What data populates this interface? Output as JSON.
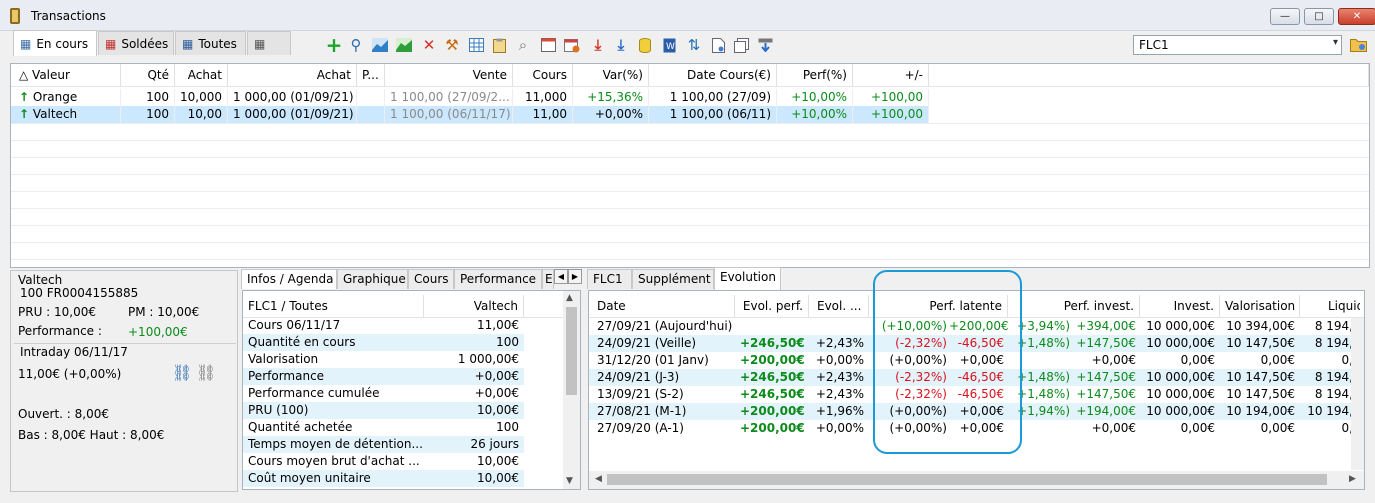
{
  "window": {
    "title": "Transactions",
    "minimize": "—",
    "maximize": "□",
    "close": "✕"
  },
  "main_tabs": [
    {
      "label": "En cours"
    },
    {
      "label": "Soldées"
    },
    {
      "label": "Toutes"
    }
  ],
  "toolbar": {
    "icons": [
      "add-icon",
      "search-icon",
      "chart-area-icon",
      "chart-green-icon",
      "delete-icon",
      "hammer-icon",
      "table-icon",
      "clipboard-icon",
      "paperclip-icon",
      "window-icon",
      "calendar-icon",
      "download-red-icon",
      "download-blue-icon",
      "database-icon",
      "word-icon",
      "transfer-icon",
      "document-icon",
      "copy-icon",
      "export-icon"
    ],
    "portfolio_select": "FLC1"
  },
  "positions": {
    "columns": [
      "Valeur",
      "Qté",
      "Achat",
      "Achat",
      "P...",
      "Vente",
      "Cours",
      "Var(%)",
      "Date Cours(€)",
      "Perf(%)",
      "+/-"
    ],
    "rows": [
      {
        "valeur": "Orange",
        "qte": "100",
        "achat": "10,000",
        "achat_total": "1 000,00 (01/09/21)",
        "vente": "1 100,00 (27/09/2...",
        "cours": "11,000",
        "var": "+15,36%",
        "date_cours": "1 100,00 (27/09)",
        "perf": "+10,00%",
        "pm": "+100,00"
      },
      {
        "valeur": "Valtech",
        "qte": "100",
        "achat": "10,00",
        "achat_total": "1 000,00 (01/09/21)",
        "vente": "1 100,00 (06/11/17)",
        "cours": "11,00",
        "var": "+0,00%",
        "date_cours": "1 100,00 (06/11)",
        "perf": "+10,00%",
        "pm": "+100,00"
      }
    ]
  },
  "detail": {
    "name": "Valtech",
    "isin": "100 FR0004155885",
    "pru": "PRU : 10,00€",
    "pm": "PM : 10,00€",
    "perf_label": "Performance :",
    "perf_value": "+100,00€",
    "intraday_title": "Intraday 06/11/17",
    "intraday_value": "11,00€ (+0,00%)",
    "ouvert": "Ouvert. : 8,00€",
    "bas_haut": "Bas : 8,00€ Haut : 8,00€"
  },
  "info_tabs": [
    "Infos / Agenda",
    "Graphique",
    "Cours",
    "Performance",
    "E"
  ],
  "info_table": {
    "header_left": "FLC1 / Toutes",
    "header_right": "Valtech",
    "rows": [
      {
        "label": "Cours 06/11/17",
        "value": "11,00€"
      },
      {
        "label": "Quantité en cours",
        "value": "100"
      },
      {
        "label": "Valorisation",
        "value": "1 000,00€"
      },
      {
        "label": "Performance",
        "value": "+0,00€"
      },
      {
        "label": "Performance cumulée",
        "value": "+0,00€"
      },
      {
        "label": "PRU (100)",
        "value": "10,00€"
      },
      {
        "label": "Quantité achetée",
        "value": "100"
      },
      {
        "label": "Temps moyen de détention...",
        "value": "26 jours"
      },
      {
        "label": "Cours moyen brut d'achat ...",
        "value": "10,00€"
      },
      {
        "label": "Coût moyen unitaire",
        "value": "10,00€"
      }
    ]
  },
  "evo_tabs": [
    "FLC1",
    "Supplément",
    "Evolution"
  ],
  "evolution": {
    "columns": [
      "Date",
      "Evol. perf.",
      "Evol. ...",
      "Perf. latente",
      "Perf. invest.",
      "Invest.",
      "Valorisation",
      "Liquid"
    ],
    "rows": [
      {
        "date": "27/09/21 (Aujourd'hui)",
        "evol_perf": "",
        "evol": "",
        "perf_lat_a": "(+10,00%)",
        "perf_lat_b": "+200,00€",
        "perf_inv_a": "+3,94%)",
        "perf_inv_b": "+394,00€",
        "invest": "10 000,00€",
        "valo": "10 394,00€",
        "liq": "8 194,"
      },
      {
        "date": "24/09/21 (Veille)",
        "evol_perf": "+246,50€",
        "evol": "+2,43%",
        "perf_lat_a": "(-2,32%)",
        "perf_lat_b": "-46,50€",
        "perf_inv_a": "+1,48%)",
        "perf_inv_b": "+147,50€",
        "invest": "10 000,00€",
        "valo": "10 147,50€",
        "liq": "8 194,"
      },
      {
        "date": "31/12/20 (01 Janv)",
        "evol_perf": "+200,00€",
        "evol": "+0,00%",
        "perf_lat_a": "(+0,00%)",
        "perf_lat_b": "+0,00€",
        "perf_inv_a": "",
        "perf_inv_b": "+0,00€",
        "invest": "0,00€",
        "valo": "0,00€",
        "liq": "0,"
      },
      {
        "date": "24/09/21 (J-3)",
        "evol_perf": "+246,50€",
        "evol": "+2,43%",
        "perf_lat_a": "(-2,32%)",
        "perf_lat_b": "-46,50€",
        "perf_inv_a": "+1,48%)",
        "perf_inv_b": "+147,50€",
        "invest": "10 000,00€",
        "valo": "10 147,50€",
        "liq": "8 194,"
      },
      {
        "date": "13/09/21 (S-2)",
        "evol_perf": "+246,50€",
        "evol": "+2,43%",
        "perf_lat_a": "(-2,32%)",
        "perf_lat_b": "-46,50€",
        "perf_inv_a": "+1,48%)",
        "perf_inv_b": "+147,50€",
        "invest": "10 000,00€",
        "valo": "10 147,50€",
        "liq": "8 194,"
      },
      {
        "date": "27/08/21 (M-1)",
        "evol_perf": "+200,00€",
        "evol": "+1,96%",
        "perf_lat_a": "(+0,00%)",
        "perf_lat_b": "+0,00€",
        "perf_inv_a": "+1,94%)",
        "perf_inv_b": "+194,00€",
        "invest": "10 000,00€",
        "valo": "10 194,00€",
        "liq": "10 194,"
      },
      {
        "date": "27/09/20 (A-1)",
        "evol_perf": "+200,00€",
        "evol": "+0,00%",
        "perf_lat_a": "(+0,00%)",
        "perf_lat_b": "+0,00€",
        "perf_inv_a": "",
        "perf_inv_b": "+0,00€",
        "invest": "0,00€",
        "valo": "0,00€",
        "liq": "0,"
      }
    ]
  },
  "colors": {
    "positive": "#0c8a1b",
    "negative": "#d8141c",
    "highlight": "#cce8ff",
    "zebra": "#e3f3fb",
    "accent_ring": "#1a9ad6"
  }
}
